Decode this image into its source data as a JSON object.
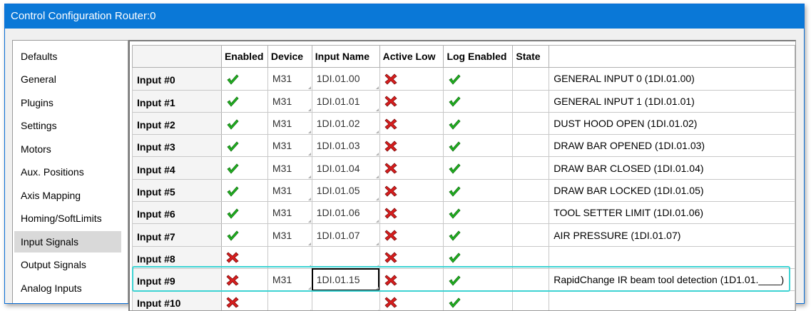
{
  "window": {
    "title": "Control Configuration Router:0"
  },
  "sidebar": {
    "items": [
      {
        "label": "Defaults"
      },
      {
        "label": "General"
      },
      {
        "label": "Plugins"
      },
      {
        "label": "Settings"
      },
      {
        "label": "Motors"
      },
      {
        "label": "Aux. Positions"
      },
      {
        "label": "Axis Mapping"
      },
      {
        "label": "Homing/SoftLimits"
      },
      {
        "label": "Input Signals",
        "selected": true
      },
      {
        "label": "Output Signals"
      },
      {
        "label": "Analog Inputs"
      }
    ]
  },
  "grid": {
    "headers": [
      "",
      "Enabled",
      "Device",
      "Input Name",
      "Active Low",
      "Log Enabled",
      "State",
      ""
    ],
    "rows": [
      {
        "label": "Input #0",
        "enabled": true,
        "device": "M31",
        "input_name": "1DI.01.00",
        "active_low": false,
        "log_enabled": true,
        "description": "GENERAL INPUT 0 (1DI.01.00)"
      },
      {
        "label": "Input #1",
        "enabled": true,
        "device": "M31",
        "input_name": "1DI.01.01",
        "active_low": false,
        "log_enabled": true,
        "description": "GENERAL INPUT 1 (1DI.01.01)"
      },
      {
        "label": "Input #2",
        "enabled": true,
        "device": "M31",
        "input_name": "1DI.01.02",
        "active_low": false,
        "log_enabled": true,
        "description": "DUST HOOD OPEN (1DI.01.02)"
      },
      {
        "label": "Input #3",
        "enabled": true,
        "device": "M31",
        "input_name": "1DI.01.03",
        "active_low": false,
        "log_enabled": true,
        "description": "DRAW BAR OPENED (1DI.01.03)"
      },
      {
        "label": "Input #4",
        "enabled": true,
        "device": "M31",
        "input_name": "1DI.01.04",
        "active_low": false,
        "log_enabled": true,
        "description": "DRAW BAR CLOSED (1DI.01.04)"
      },
      {
        "label": "Input #5",
        "enabled": true,
        "device": "M31",
        "input_name": "1DI.01.05",
        "active_low": false,
        "log_enabled": true,
        "description": "DRAW BAR LOCKED (1DI.01.05)"
      },
      {
        "label": "Input #6",
        "enabled": true,
        "device": "M31",
        "input_name": "1DI.01.06",
        "active_low": false,
        "log_enabled": true,
        "description": "TOOL SETTER LIMIT (1DI.01.06)"
      },
      {
        "label": "Input #7",
        "enabled": true,
        "device": "M31",
        "input_name": "1DI.01.07",
        "active_low": false,
        "log_enabled": true,
        "description": "AIR PRESSURE (1DI.01.07)"
      },
      {
        "label": "Input #8",
        "enabled": false,
        "device": "",
        "input_name": "",
        "active_low": false,
        "log_enabled": true,
        "description": ""
      },
      {
        "label": "Input #9",
        "enabled": false,
        "device": "M31",
        "input_name": "1DI.01.15",
        "active_low": false,
        "log_enabled": true,
        "description": "RapidChange IR beam tool detection (1D1.01.____)",
        "focused": true
      },
      {
        "label": "Input #10",
        "enabled": false,
        "device": "",
        "input_name": "",
        "active_low": false,
        "log_enabled": true,
        "description": ""
      }
    ]
  },
  "colors": {
    "titlebar": "#0a78d7",
    "check_green": "#22b422",
    "cross_red": "#d81e1e",
    "highlight": "#3ed3d3"
  },
  "icons": {
    "check": "green-check-icon",
    "cross": "red-x-icon"
  }
}
